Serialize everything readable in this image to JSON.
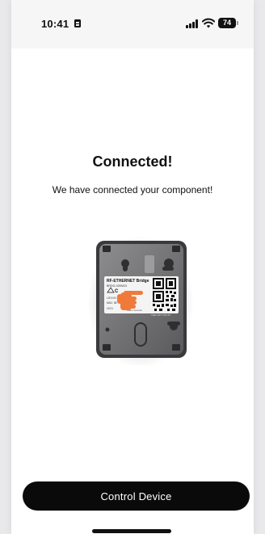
{
  "status_bar": {
    "time": "10:41",
    "battery_level": "74"
  },
  "main": {
    "title": "Connected!",
    "subtitle": "We have connected your component!"
  },
  "device_image": {
    "label_title": "RF-ETHERNET Bridge",
    "label_model": "BRDG-02EM23",
    "label_mac": "MAC: 58",
    "label_voltage": "LIS 5.0V",
    "label_serial": "19 01",
    "label_made": "Made in Denmark",
    "label_code": "7HE2 J4ZY C53F 5C"
  },
  "actions": {
    "control_device_label": "Control Device"
  },
  "colors": {
    "button_bg": "#0a0a0a",
    "pointer_hand": "#f07a3a"
  }
}
